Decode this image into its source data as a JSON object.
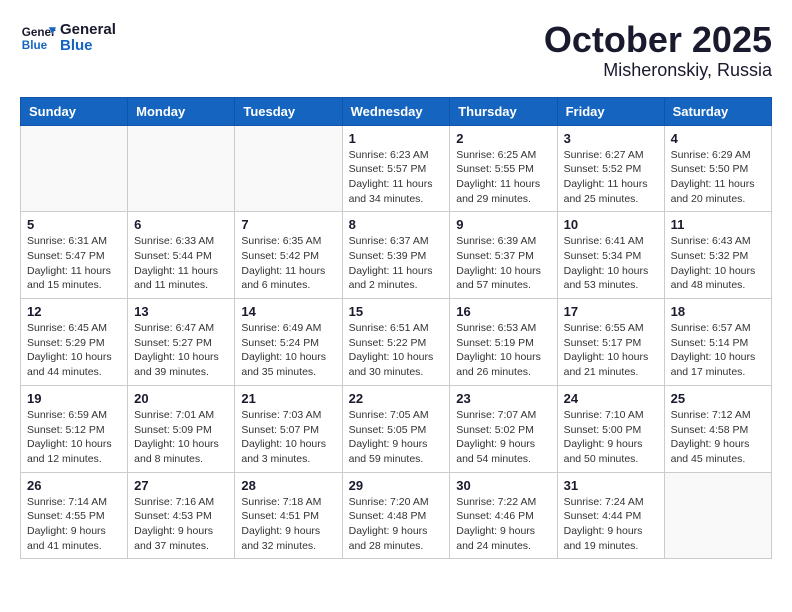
{
  "logo": {
    "line1": "General",
    "line2": "Blue"
  },
  "title": "October 2025",
  "subtitle": "Misheronskiy, Russia",
  "headers": [
    "Sunday",
    "Monday",
    "Tuesday",
    "Wednesday",
    "Thursday",
    "Friday",
    "Saturday"
  ],
  "weeks": [
    [
      {
        "day": "",
        "info": ""
      },
      {
        "day": "",
        "info": ""
      },
      {
        "day": "",
        "info": ""
      },
      {
        "day": "1",
        "info": "Sunrise: 6:23 AM\nSunset: 5:57 PM\nDaylight: 11 hours\nand 34 minutes."
      },
      {
        "day": "2",
        "info": "Sunrise: 6:25 AM\nSunset: 5:55 PM\nDaylight: 11 hours\nand 29 minutes."
      },
      {
        "day": "3",
        "info": "Sunrise: 6:27 AM\nSunset: 5:52 PM\nDaylight: 11 hours\nand 25 minutes."
      },
      {
        "day": "4",
        "info": "Sunrise: 6:29 AM\nSunset: 5:50 PM\nDaylight: 11 hours\nand 20 minutes."
      }
    ],
    [
      {
        "day": "5",
        "info": "Sunrise: 6:31 AM\nSunset: 5:47 PM\nDaylight: 11 hours\nand 15 minutes."
      },
      {
        "day": "6",
        "info": "Sunrise: 6:33 AM\nSunset: 5:44 PM\nDaylight: 11 hours\nand 11 minutes."
      },
      {
        "day": "7",
        "info": "Sunrise: 6:35 AM\nSunset: 5:42 PM\nDaylight: 11 hours\nand 6 minutes."
      },
      {
        "day": "8",
        "info": "Sunrise: 6:37 AM\nSunset: 5:39 PM\nDaylight: 11 hours\nand 2 minutes."
      },
      {
        "day": "9",
        "info": "Sunrise: 6:39 AM\nSunset: 5:37 PM\nDaylight: 10 hours\nand 57 minutes."
      },
      {
        "day": "10",
        "info": "Sunrise: 6:41 AM\nSunset: 5:34 PM\nDaylight: 10 hours\nand 53 minutes."
      },
      {
        "day": "11",
        "info": "Sunrise: 6:43 AM\nSunset: 5:32 PM\nDaylight: 10 hours\nand 48 minutes."
      }
    ],
    [
      {
        "day": "12",
        "info": "Sunrise: 6:45 AM\nSunset: 5:29 PM\nDaylight: 10 hours\nand 44 minutes."
      },
      {
        "day": "13",
        "info": "Sunrise: 6:47 AM\nSunset: 5:27 PM\nDaylight: 10 hours\nand 39 minutes."
      },
      {
        "day": "14",
        "info": "Sunrise: 6:49 AM\nSunset: 5:24 PM\nDaylight: 10 hours\nand 35 minutes."
      },
      {
        "day": "15",
        "info": "Sunrise: 6:51 AM\nSunset: 5:22 PM\nDaylight: 10 hours\nand 30 minutes."
      },
      {
        "day": "16",
        "info": "Sunrise: 6:53 AM\nSunset: 5:19 PM\nDaylight: 10 hours\nand 26 minutes."
      },
      {
        "day": "17",
        "info": "Sunrise: 6:55 AM\nSunset: 5:17 PM\nDaylight: 10 hours\nand 21 minutes."
      },
      {
        "day": "18",
        "info": "Sunrise: 6:57 AM\nSunset: 5:14 PM\nDaylight: 10 hours\nand 17 minutes."
      }
    ],
    [
      {
        "day": "19",
        "info": "Sunrise: 6:59 AM\nSunset: 5:12 PM\nDaylight: 10 hours\nand 12 minutes."
      },
      {
        "day": "20",
        "info": "Sunrise: 7:01 AM\nSunset: 5:09 PM\nDaylight: 10 hours\nand 8 minutes."
      },
      {
        "day": "21",
        "info": "Sunrise: 7:03 AM\nSunset: 5:07 PM\nDaylight: 10 hours\nand 3 minutes."
      },
      {
        "day": "22",
        "info": "Sunrise: 7:05 AM\nSunset: 5:05 PM\nDaylight: 9 hours\nand 59 minutes."
      },
      {
        "day": "23",
        "info": "Sunrise: 7:07 AM\nSunset: 5:02 PM\nDaylight: 9 hours\nand 54 minutes."
      },
      {
        "day": "24",
        "info": "Sunrise: 7:10 AM\nSunset: 5:00 PM\nDaylight: 9 hours\nand 50 minutes."
      },
      {
        "day": "25",
        "info": "Sunrise: 7:12 AM\nSunset: 4:58 PM\nDaylight: 9 hours\nand 45 minutes."
      }
    ],
    [
      {
        "day": "26",
        "info": "Sunrise: 7:14 AM\nSunset: 4:55 PM\nDaylight: 9 hours\nand 41 minutes."
      },
      {
        "day": "27",
        "info": "Sunrise: 7:16 AM\nSunset: 4:53 PM\nDaylight: 9 hours\nand 37 minutes."
      },
      {
        "day": "28",
        "info": "Sunrise: 7:18 AM\nSunset: 4:51 PM\nDaylight: 9 hours\nand 32 minutes."
      },
      {
        "day": "29",
        "info": "Sunrise: 7:20 AM\nSunset: 4:48 PM\nDaylight: 9 hours\nand 28 minutes."
      },
      {
        "day": "30",
        "info": "Sunrise: 7:22 AM\nSunset: 4:46 PM\nDaylight: 9 hours\nand 24 minutes."
      },
      {
        "day": "31",
        "info": "Sunrise: 7:24 AM\nSunset: 4:44 PM\nDaylight: 9 hours\nand 19 minutes."
      },
      {
        "day": "",
        "info": ""
      }
    ]
  ]
}
